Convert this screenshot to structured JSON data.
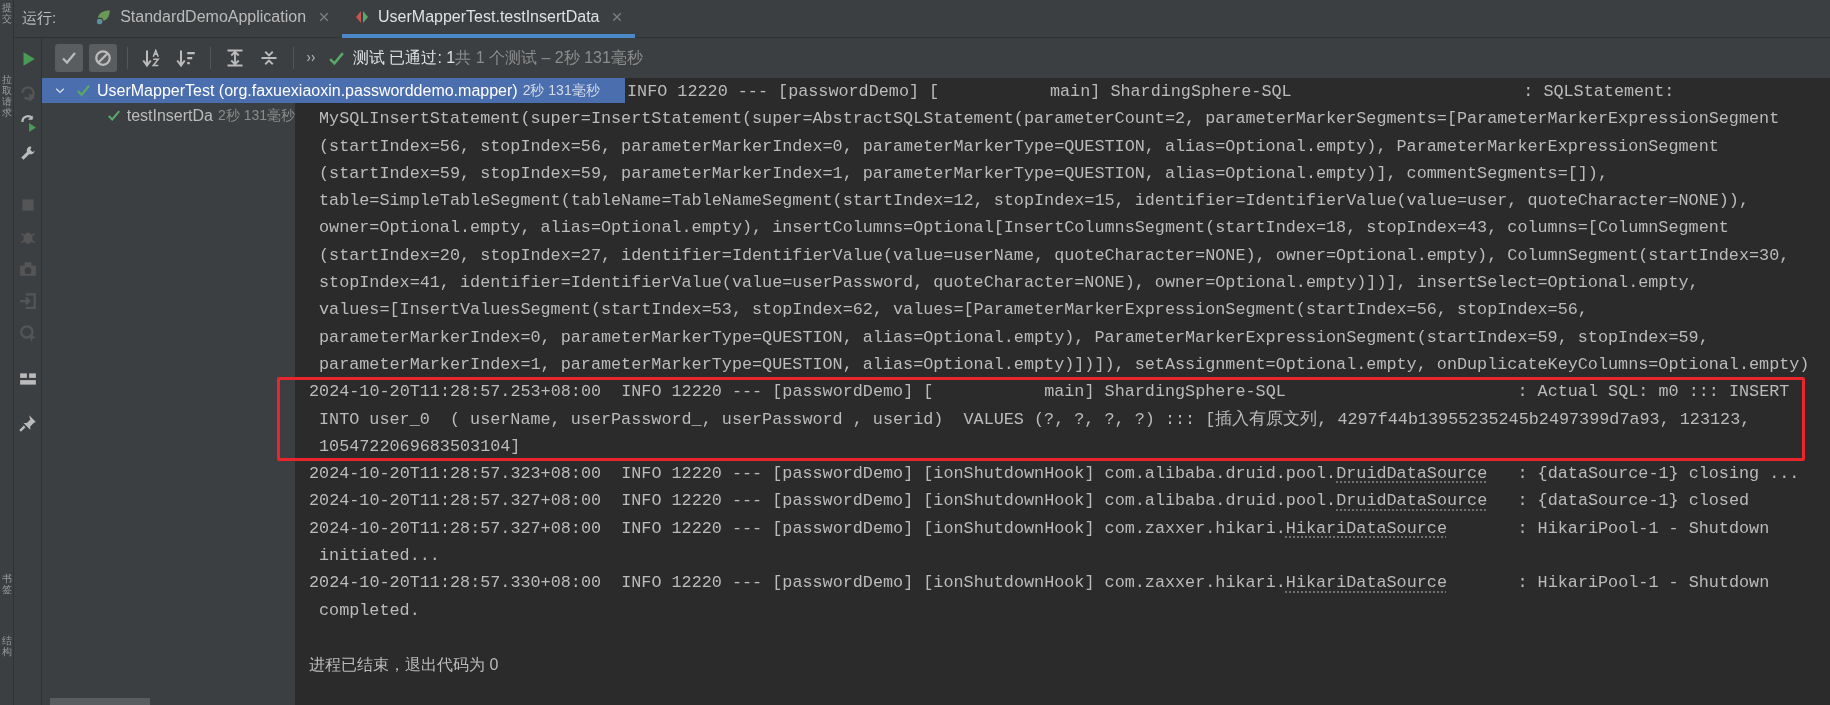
{
  "edge_labels": [
    "提交",
    "拉取请求",
    "书签",
    "结构"
  ],
  "run_bar": {
    "label": "运行:",
    "tabs": [
      {
        "kind": "app",
        "label": "StandardDemoApplication",
        "selected": false
      },
      {
        "kind": "test",
        "label": "UserMapperTest.testInsertData",
        "selected": true
      }
    ]
  },
  "toolbar": {
    "buttons": [
      {
        "kind": "passed",
        "on": true
      },
      {
        "kind": "ignored",
        "on": true
      }
    ],
    "status": "测试 已通过: 1",
    "summary": "共 1 个测试 – 2秒 131毫秒"
  },
  "test_tree": [
    {
      "label": "UserMapperTest (org.faxuexiaoxin.passworddemo.mapper)",
      "duration": "2秒 131毫秒",
      "selected": true,
      "expanded": true,
      "children": [
        {
          "label": "testInsertDa",
          "duration": "2秒 131毫秒",
          "selected": false
        }
      ]
    }
  ],
  "console": {
    "entries": [
      {
        "highlighted": false,
        "lines": [
          {
            "kind": "cut",
            "text": "INFO 12220 --- [passwordDemo] [           main] ShardingSphere-SQL                       : SQLStatement:"
          },
          {
            "kind": "cont",
            "text": "MySQLInsertStatement(super=InsertStatement(super=AbstractSQLStatement(parameterCount=2, parameterMarkerSegments=[ParameterMarkerExpressionSegment"
          },
          {
            "kind": "cont",
            "text": "(startIndex=56, stopIndex=56, parameterMarkerIndex=0, parameterMarkerType=QUESTION, alias=Optional.empty), ParameterMarkerExpressionSegment"
          },
          {
            "kind": "cont",
            "text": "(startIndex=59, stopIndex=59, parameterMarkerIndex=1, parameterMarkerType=QUESTION, alias=Optional.empty)], commentSegments=[]),"
          },
          {
            "kind": "cont",
            "text": "table=SimpleTableSegment(tableName=TableNameSegment(startIndex=12, stopIndex=15, identifier=IdentifierValue(value=user, quoteCharacter=NONE)),"
          },
          {
            "kind": "cont",
            "text": "owner=Optional.empty, alias=Optional.empty), insertColumns=Optional[InsertColumnsSegment(startIndex=18, stopIndex=43, columns=[ColumnSegment"
          },
          {
            "kind": "cont",
            "text": "(startIndex=20, stopIndex=27, identifier=IdentifierValue(value=userName, quoteCharacter=NONE), owner=Optional.empty), ColumnSegment(startIndex=30,"
          },
          {
            "kind": "cont",
            "text": "stopIndex=41, identifier=IdentifierValue(value=userPassword, quoteCharacter=NONE), owner=Optional.empty)])], insertSelect=Optional.empty,"
          },
          {
            "kind": "cont",
            "text": "values=[InsertValuesSegment(startIndex=53, stopIndex=62, values=[ParameterMarkerExpressionSegment(startIndex=56, stopIndex=56,"
          },
          {
            "kind": "cont",
            "text": "parameterMarkerIndex=0, parameterMarkerType=QUESTION, alias=Optional.empty), ParameterMarkerExpressionSegment(startIndex=59, stopIndex=59,"
          },
          {
            "kind": "cont",
            "text": "parameterMarkerIndex=1, parameterMarkerType=QUESTION, alias=Optional.empty)])]), setAssignment=Optional.empty, onDuplicateKeyColumns=Optional.empty)"
          }
        ]
      },
      {
        "highlighted": true,
        "lines": [
          {
            "kind": "head",
            "text": "2024-10-20T11:28:57.253+08:00  INFO 12220 --- [passwordDemo] [           main] ShardingSphere-SQL                       : Actual SQL: m0 ::: INSERT"
          },
          {
            "kind": "cont",
            "text": "INTO user_0  ( userName, userPassword_, userPassword , userid)  VALUES (?, ?, ?, ?) ::: [插入有原文列, 4297f44b13955235245b2497399d7a93, 123123,"
          },
          {
            "kind": "cont",
            "text": "1054722069683503104]"
          }
        ]
      },
      {
        "highlighted": false,
        "lines": [
          {
            "kind": "head",
            "text": "2024-10-20T11:28:57.323+08:00  INFO 12220 --- [passwordDemo] [ionShutdownHook] com.alibaba.druid.pool.",
            "link": "DruidDataSource",
            "after": "   : {dataSource-1} closing ..."
          }
        ]
      },
      {
        "highlighted": false,
        "lines": [
          {
            "kind": "head",
            "text": "2024-10-20T11:28:57.327+08:00  INFO 12220 --- [passwordDemo] [ionShutdownHook] com.alibaba.druid.pool.",
            "link": "DruidDataSource",
            "after": "   : {dataSource-1} closed"
          }
        ]
      },
      {
        "highlighted": false,
        "lines": [
          {
            "kind": "head",
            "text": "2024-10-20T11:28:57.327+08:00  INFO 12220 --- [passwordDemo] [ionShutdownHook] com.zaxxer.hikari.",
            "link": "HikariDataSource",
            "after": "       : HikariPool-1 - Shutdown"
          },
          {
            "kind": "cont",
            "text": "initiated..."
          }
        ]
      },
      {
        "highlighted": false,
        "lines": [
          {
            "kind": "head",
            "text": "2024-10-20T11:28:57.330+08:00  INFO 12220 --- [passwordDemo] [ionShutdownHook] com.zaxxer.hikari.",
            "link": "HikariDataSource",
            "after": "       : HikariPool-1 - Shutdown"
          },
          {
            "kind": "cont",
            "text": "completed."
          }
        ]
      }
    ],
    "exit_message": "进程已结束，退出代码为 0"
  }
}
